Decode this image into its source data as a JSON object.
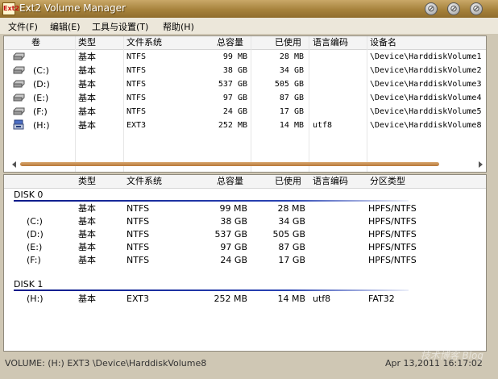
{
  "window": {
    "title": "Ext2 Volume Manager",
    "icon": "Ext2"
  },
  "menu": [
    "文件(F)",
    "编辑(E)",
    "工具与设置(T)",
    "帮助(H)"
  ],
  "volumes": {
    "headers": [
      "卷",
      "类型",
      "文件系统",
      "总容量",
      "已使用",
      "语言编码",
      "设备名"
    ],
    "rows": [
      {
        "icon": "hard-drive-icon",
        "vol": "",
        "type": "基本",
        "fs": "NTFS",
        "total": "99 MB",
        "used": "28 MB",
        "codepage": "",
        "device": "\\Device\\HarddiskVolume1"
      },
      {
        "icon": "hard-drive-icon",
        "vol": "(C:)",
        "type": "基本",
        "fs": "NTFS",
        "total": "38 GB",
        "used": "34 GB",
        "codepage": "",
        "device": "\\Device\\HarddiskVolume2"
      },
      {
        "icon": "hard-drive-icon",
        "vol": "(D:)",
        "type": "基本",
        "fs": "NTFS",
        "total": "537 GB",
        "used": "505 GB",
        "codepage": "",
        "device": "\\Device\\HarddiskVolume3"
      },
      {
        "icon": "hard-drive-icon",
        "vol": "(E:)",
        "type": "基本",
        "fs": "NTFS",
        "total": "97 GB",
        "used": "87 GB",
        "codepage": "",
        "device": "\\Device\\HarddiskVolume4"
      },
      {
        "icon": "hard-drive-icon",
        "vol": "(F:)",
        "type": "基本",
        "fs": "NTFS",
        "total": "24 GB",
        "used": "17 GB",
        "codepage": "",
        "device": "\\Device\\HarddiskVolume5"
      },
      {
        "icon": "usb-drive-icon",
        "vol": "(H:)",
        "type": "基本",
        "fs": "EXT3",
        "total": "252 MB",
        "used": "14 MB",
        "codepage": "utf8",
        "device": "\\Device\\HarddiskVolume8"
      }
    ]
  },
  "partitions": {
    "headers": [
      "",
      "类型",
      "文件系统",
      "总容量",
      "已使用",
      "语言编码",
      "分区类型"
    ],
    "disks": [
      {
        "name": "DISK 0",
        "rows": [
          {
            "vol": "",
            "type": "基本",
            "fs": "NTFS",
            "total": "99 MB",
            "used": "28 MB",
            "codepage": "",
            "ptype": "HPFS/NTFS"
          },
          {
            "vol": "(C:)",
            "type": "基本",
            "fs": "NTFS",
            "total": "38 GB",
            "used": "34 GB",
            "codepage": "",
            "ptype": "HPFS/NTFS"
          },
          {
            "vol": "(D:)",
            "type": "基本",
            "fs": "NTFS",
            "total": "537 GB",
            "used": "505 GB",
            "codepage": "",
            "ptype": "HPFS/NTFS"
          },
          {
            "vol": "(E:)",
            "type": "基本",
            "fs": "NTFS",
            "total": "97 GB",
            "used": "87 GB",
            "codepage": "",
            "ptype": "HPFS/NTFS"
          },
          {
            "vol": "(F:)",
            "type": "基本",
            "fs": "NTFS",
            "total": "24 GB",
            "used": "17 GB",
            "codepage": "",
            "ptype": "HPFS/NTFS"
          }
        ]
      },
      {
        "name": "DISK 1",
        "rows": [
          {
            "vol": "(H:)",
            "type": "基本",
            "fs": "EXT3",
            "total": "252 MB",
            "used": "14 MB",
            "codepage": "utf8",
            "ptype": "FAT32"
          }
        ]
      }
    ]
  },
  "status": {
    "left": "VOLUME: (H:) EXT3 \\Device\\HarddiskVolume8",
    "right": "Apr 13,2011 16:17:02"
  },
  "watermark": {
    "line1": "51CTO.com",
    "line2": "技术博客 Blog"
  },
  "colors": {
    "title_bar": "#a6823c",
    "disk_line": "#0c1a8a"
  }
}
